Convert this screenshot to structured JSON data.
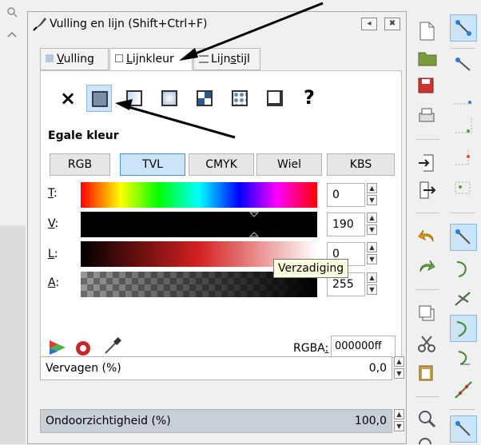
{
  "panel": {
    "title": "Vulling en lijn (Shift+Ctrl+F)",
    "dock_button": "◂",
    "close_button": "✖"
  },
  "tabs": [
    {
      "pre": "",
      "underlined": "V",
      "post": "ulling"
    },
    {
      "pre": "",
      "underlined": "L",
      "post": "ijnkleur"
    },
    {
      "pre": "Lijn",
      "underlined": "s",
      "post": "tijl"
    }
  ],
  "paint_types": [
    "none",
    "flat-color",
    "linear-gradient",
    "radial-gradient",
    "pattern",
    "swatch",
    "unset"
  ],
  "paint_none_glyph": "×",
  "paint_unset_glyph": "?",
  "section_label": "Egale kleur",
  "modes": [
    "RGB",
    "TVL",
    "CMYK",
    "Wiel",
    "KBS"
  ],
  "selected_mode": "TVL",
  "sliders": [
    {
      "underlined": "T",
      "suffix": ":",
      "value": "0"
    },
    {
      "underlined": "V",
      "suffix": ":",
      "value": "190"
    },
    {
      "underlined": "L",
      "suffix": ":",
      "value": "0"
    },
    {
      "underlined": "A",
      "suffix": ":",
      "value": "255"
    }
  ],
  "tooltip": "Verzadiging",
  "rgba": {
    "label_pre": "RGBA",
    "label_underlined": ":",
    "value": "000000ff"
  },
  "blur": {
    "label": "Vervagen (%)",
    "value": "0,0"
  },
  "opacity": {
    "label": "Ondoorzichtigheid (%)",
    "value": "100,0"
  },
  "colors": {
    "accent": "#cce4f7",
    "accent_border": "#4a90d9",
    "tooltip_bg": "#ffffe1",
    "opacity_bar": "#c9cfd6"
  }
}
